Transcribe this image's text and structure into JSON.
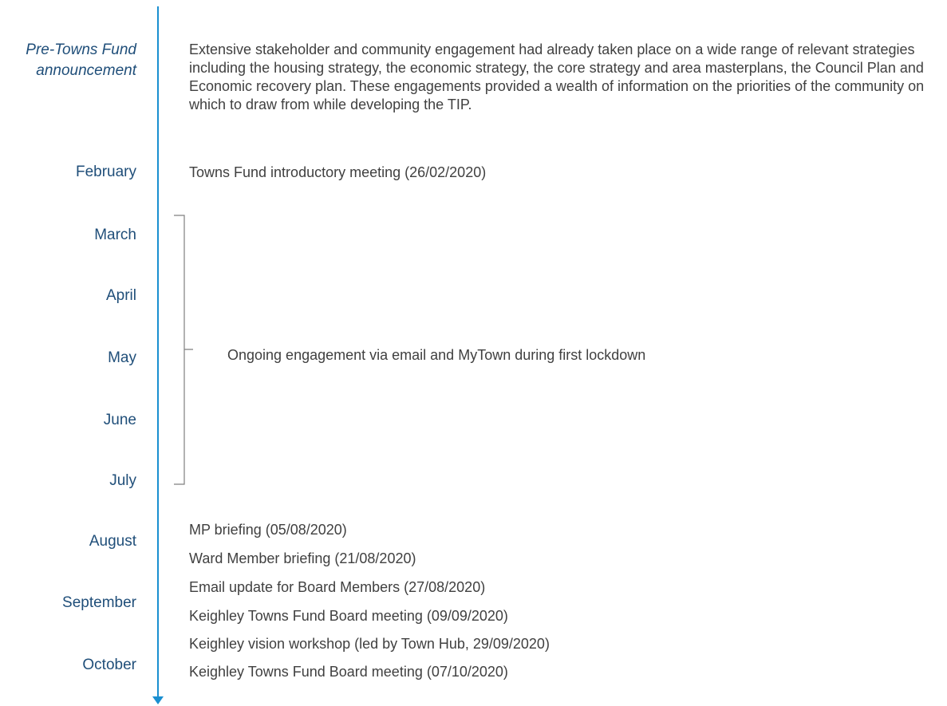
{
  "pre_announcement": {
    "label_line1": "Pre-Towns Fund",
    "label_line2": "announcement",
    "text": "Extensive stakeholder and community engagement had already taken place on a wide range of relevant strategies including the housing strategy, the economic strategy, the core strategy and area masterplans, the Council Plan and Economic recovery plan.  These engagements provided a wealth of information on the priorities of the community on which to draw from while developing the TIP."
  },
  "months": [
    "February",
    "March",
    "April",
    "May",
    "June",
    "July",
    "August",
    "September",
    "October"
  ],
  "february_event": "Towns Fund introductory meeting (26/02/2020)",
  "ongoing_engagement": "Ongoing engagement via  email and MyTown during first lockdown",
  "events": [
    "MP briefing (05/08/2020)",
    "Ward Member briefing (21/08/2020)",
    "Email update for Board Members (27/08/2020)",
    "Keighley Towns Fund Board meeting (09/09/2020)",
    "Keighley vision workshop (led by Town Hub, 29/09/2020)",
    "Keighley Towns Fund Board meeting (07/10/2020)"
  ],
  "colors": {
    "timeline": "#1a8fd0",
    "month_text": "#1f4e79",
    "body_text": "#404040",
    "bracket": "#7f7f7f"
  }
}
